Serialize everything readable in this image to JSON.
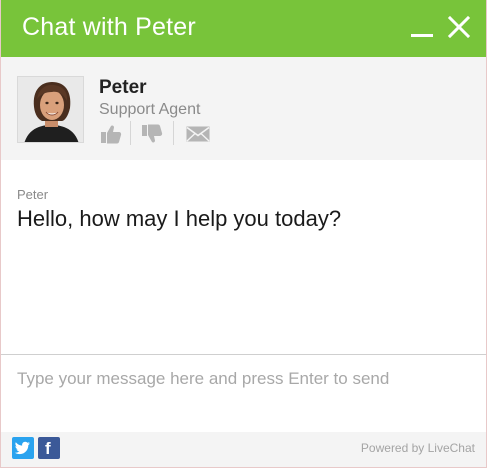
{
  "window": {
    "title": "Chat with Peter",
    "minimize_icon": "minimize-icon",
    "close_icon": "close-icon"
  },
  "agent": {
    "name": "Peter",
    "role": "Support Agent",
    "avatar": "agent-photo",
    "actions": [
      {
        "icon": "thumbs-up-icon"
      },
      {
        "icon": "thumbs-down-icon"
      },
      {
        "icon": "envelope-icon"
      }
    ]
  },
  "messages": [
    {
      "author": "Peter",
      "text": "Hello, how may I help you today?"
    }
  ],
  "composer": {
    "placeholder": "Type your message here and press Enter to send",
    "value": ""
  },
  "footer": {
    "social": [
      {
        "icon": "twitter-icon"
      },
      {
        "icon": "facebook-icon"
      }
    ],
    "powered_by": "Powered by LiveChat"
  },
  "colors": {
    "accent": "#78c43a",
    "panel": "#f4f4f4",
    "twitter": "#2aa3ef",
    "facebook": "#3b5998"
  }
}
